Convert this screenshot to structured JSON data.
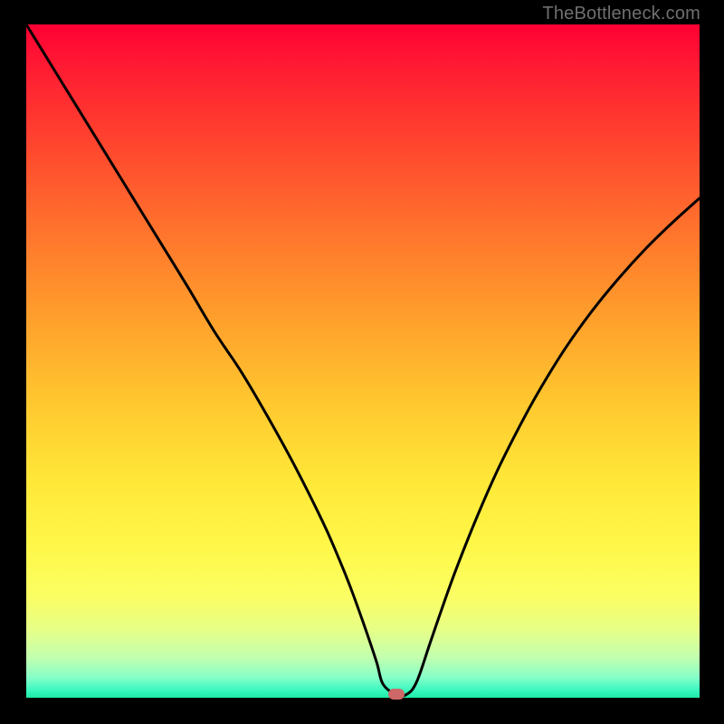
{
  "attribution": "TheBottleneck.com",
  "colors": {
    "curve_stroke": "#000000",
    "marker_fill": "#ce6868"
  },
  "chart_data": {
    "type": "line",
    "title": "",
    "xlabel": "",
    "ylabel": "",
    "xlim": [
      0,
      100
    ],
    "ylim": [
      0,
      100
    ],
    "grid": false,
    "series": [
      {
        "name": "curve",
        "x": [
          0,
          4,
          8,
          12,
          16,
          20,
          24,
          28,
          32,
          36,
          40,
          44,
          46,
          48,
          50,
          52,
          53,
          55,
          56.5,
          58,
          60,
          62,
          64,
          67,
          70,
          73,
          76,
          80,
          84,
          88,
          92,
          96,
          100
        ],
        "values": [
          100,
          93.5,
          87,
          80.5,
          74,
          67.5,
          61,
          54.3,
          48.3,
          41.5,
          34.2,
          26.2,
          21.7,
          16.8,
          11.3,
          5.4,
          2.0,
          0.5,
          0.5,
          2.4,
          8.2,
          14.0,
          19.5,
          27.0,
          33.8,
          39.8,
          45.3,
          51.8,
          57.4,
          62.3,
          66.7,
          70.6,
          74.2
        ]
      }
    ],
    "marker": {
      "x": 55,
      "y": 0.5
    }
  }
}
